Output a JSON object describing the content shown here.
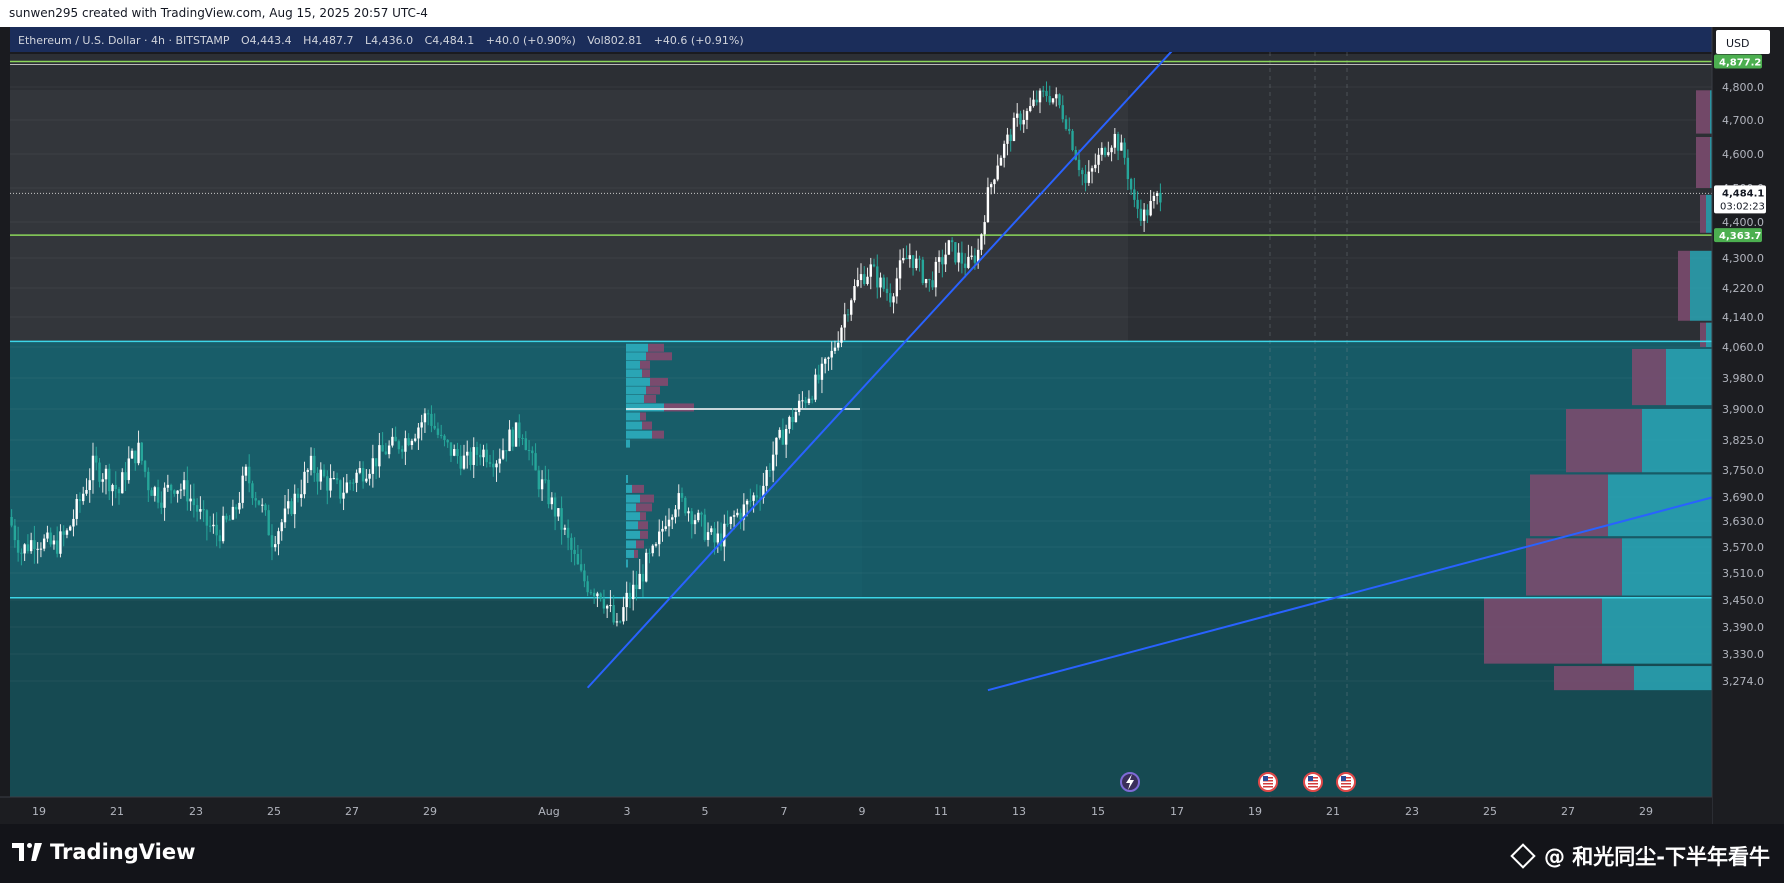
{
  "header": {
    "attribution": "sunwen295 created with TradingView.com, Aug 15, 2025 20:57 UTC-4"
  },
  "legend": {
    "symbol": "Ethereum / U.S. Dollar · 4h · BITSTAMP",
    "open_label": "O",
    "open": "4,443.4",
    "high_label": "H",
    "high": "4,487.7",
    "low_label": "L",
    "low": "4,436.0",
    "close_label": "C",
    "close": "4,484.1",
    "change": "+40.0 (+0.90%)",
    "vol_label": "Vol",
    "vol": "802.81",
    "vol_change": "+40.6 (+0.91%)"
  },
  "currency_button": "USD",
  "price_tags": {
    "upper_level": "4,877.2",
    "last_price": "4,484.1",
    "countdown": "03:02:23",
    "support_level": "4,363.7"
  },
  "event_icons": [
    "lightning-icon",
    "us-flag-icon",
    "us-flag-icon",
    "us-flag-icon"
  ],
  "footer": {
    "brand": "TradingView",
    "watermark": "@ 和光同尘-下半年看牛"
  },
  "colors": {
    "up": "#26a69a",
    "down": "#26a69a",
    "bull_body": "#ffffff",
    "trendline": "#2962ff",
    "zone": "#175a66",
    "cyan_line": "#3cd6e8",
    "green_line": "#8bd65a",
    "header_bg": "#1b2d5a",
    "profile_up": "#2aa5b5",
    "profile_down": "#7a4b6e"
  },
  "chart_data": {
    "type": "candlestick",
    "symbol": "ETHUSD",
    "interval": "4h",
    "y_axis": {
      "ticks": [
        4800,
        4700,
        4600,
        4500,
        4400,
        4300,
        4220,
        4140,
        4060,
        3980,
        3900,
        3825,
        3750,
        3690,
        3630,
        3570,
        3510,
        3450,
        3390,
        3330,
        3274
      ],
      "tick_labels": [
        "4,800.0",
        "4,700.0",
        "4,600.0",
        "4,500.0",
        "4,400.0",
        "4,300.0",
        "4,220.0",
        "4,140.0",
        "4,060.0",
        "3,980.0",
        "3,900.0",
        "3,825.0",
        "3,750.0",
        "3,690.0",
        "3,630.0",
        "3,570.0",
        "3,510.0",
        "3,450.0",
        "3,390.0",
        "3,330.0",
        "3,274.0"
      ],
      "ylim": [
        3250,
        5000
      ]
    },
    "x_axis": {
      "tick_labels": [
        "19",
        "21",
        "23",
        "25",
        "27",
        "29",
        "Aug",
        "3",
        "5",
        "7",
        "9",
        "11",
        "13",
        "15",
        "17",
        "19",
        "21",
        "23",
        "25",
        "27",
        "29"
      ],
      "xlim_bars": [
        0,
        523
      ]
    },
    "horizontal_levels": [
      {
        "price": 4877.2,
        "style": "green"
      },
      {
        "price": 4363.7,
        "style": "green"
      },
      {
        "price": 4075,
        "style": "cyan"
      },
      {
        "price": 3455,
        "style": "cyan"
      },
      {
        "price": 3900,
        "style": "white-poc"
      }
    ],
    "trendlines": [
      {
        "from": [
          177,
          3260
        ],
        "to": [
          365,
          5000
        ]
      },
      {
        "from": [
          300,
          3255
        ],
        "to": [
          523,
          3690
        ]
      }
    ],
    "volume_profile": {
      "right": [
        {
          "lo": 4660,
          "hi": 4790,
          "up": 2,
          "down": 14
        },
        {
          "lo": 4500,
          "hi": 4650,
          "up": 2,
          "down": 14
        },
        {
          "lo": 4370,
          "hi": 4480,
          "up": 6,
          "down": 6
        },
        {
          "lo": 4130,
          "hi": 4320,
          "up": 22,
          "down": 12
        },
        {
          "lo": 4060,
          "hi": 4125,
          "up": 6,
          "down": 6
        },
        {
          "lo": 3910,
          "hi": 4055,
          "up": 46,
          "down": 34
        },
        {
          "lo": 3745,
          "hi": 3900,
          "up": 70,
          "down": 76
        },
        {
          "lo": 3595,
          "hi": 3740,
          "up": 104,
          "down": 78
        },
        {
          "lo": 3460,
          "hi": 3590,
          "up": 90,
          "down": 96
        },
        {
          "lo": 3310,
          "hi": 3455,
          "up": 110,
          "down": 118
        },
        {
          "lo": 3255,
          "hi": 3305,
          "up": 78,
          "down": 80
        }
      ],
      "left": [
        {
          "price": 4058,
          "up": 22,
          "down": 16
        },
        {
          "price": 4036,
          "up": 20,
          "down": 26
        },
        {
          "price": 4014,
          "up": 14,
          "down": 10
        },
        {
          "price": 3992,
          "up": 16,
          "down": 8
        },
        {
          "price": 3970,
          "up": 24,
          "down": 18
        },
        {
          "price": 3948,
          "up": 20,
          "down": 14
        },
        {
          "price": 3926,
          "up": 18,
          "down": 12
        },
        {
          "price": 3904,
          "up": 38,
          "down": 30
        },
        {
          "price": 3882,
          "up": 14,
          "down": 6
        },
        {
          "price": 3860,
          "up": 16,
          "down": 10
        },
        {
          "price": 3838,
          "up": 26,
          "down": 12
        },
        {
          "price": 3816,
          "up": 4,
          "down": 0
        },
        {
          "price": 3730,
          "up": 2,
          "down": 0
        },
        {
          "price": 3708,
          "up": 6,
          "down": 12
        },
        {
          "price": 3686,
          "up": 14,
          "down": 14
        },
        {
          "price": 3664,
          "up": 10,
          "down": 16
        },
        {
          "price": 3642,
          "up": 14,
          "down": 6
        },
        {
          "price": 3620,
          "up": 12,
          "down": 10
        },
        {
          "price": 3598,
          "up": 14,
          "down": 8
        },
        {
          "price": 3576,
          "up": 10,
          "down": 8
        },
        {
          "price": 3554,
          "up": 8,
          "down": 4
        },
        {
          "price": 3532,
          "up": 2,
          "down": 0
        }
      ]
    },
    "waypoints": [
      [
        0,
        3640
      ],
      [
        4,
        3560
      ],
      [
        8,
        3590
      ],
      [
        14,
        3570
      ],
      [
        18,
        3600
      ],
      [
        22,
        3680
      ],
      [
        26,
        3760
      ],
      [
        30,
        3740
      ],
      [
        34,
        3700
      ],
      [
        37,
        3770
      ],
      [
        40,
        3800
      ],
      [
        43,
        3720
      ],
      [
        47,
        3690
      ],
      [
        51,
        3720
      ],
      [
        55,
        3700
      ],
      [
        60,
        3630
      ],
      [
        64,
        3600
      ],
      [
        69,
        3640
      ],
      [
        73,
        3740
      ],
      [
        77,
        3680
      ],
      [
        81,
        3590
      ],
      [
        85,
        3640
      ],
      [
        89,
        3700
      ],
      [
        93,
        3760
      ],
      [
        97,
        3730
      ],
      [
        102,
        3700
      ],
      [
        107,
        3740
      ],
      [
        112,
        3770
      ],
      [
        116,
        3800
      ],
      [
        121,
        3820
      ],
      [
        125,
        3850
      ],
      [
        129,
        3890
      ],
      [
        133,
        3820
      ],
      [
        137,
        3790
      ],
      [
        141,
        3770
      ],
      [
        145,
        3800
      ],
      [
        150,
        3780
      ],
      [
        154,
        3830
      ],
      [
        158,
        3850
      ],
      [
        162,
        3740
      ],
      [
        166,
        3690
      ],
      [
        170,
        3620
      ],
      [
        173,
        3560
      ],
      [
        176,
        3500
      ],
      [
        179,
        3480
      ],
      [
        182,
        3470
      ],
      [
        185,
        3420
      ],
      [
        187,
        3380
      ],
      [
        190,
        3450
      ],
      [
        193,
        3480
      ],
      [
        196,
        3530
      ],
      [
        199,
        3560
      ],
      [
        202,
        3640
      ],
      [
        205,
        3680
      ],
      [
        208,
        3670
      ],
      [
        211,
        3640
      ],
      [
        214,
        3610
      ],
      [
        217,
        3580
      ],
      [
        220,
        3600
      ],
      [
        223,
        3640
      ],
      [
        226,
        3660
      ],
      [
        229,
        3690
      ],
      [
        232,
        3720
      ],
      [
        235,
        3790
      ],
      [
        238,
        3840
      ],
      [
        241,
        3880
      ],
      [
        244,
        3920
      ],
      [
        247,
        3950
      ],
      [
        250,
        3990
      ],
      [
        253,
        4040
      ],
      [
        256,
        4120
      ],
      [
        259,
        4200
      ],
      [
        262,
        4250
      ],
      [
        265,
        4270
      ],
      [
        268,
        4230
      ],
      [
        271,
        4200
      ],
      [
        274,
        4270
      ],
      [
        277,
        4310
      ],
      [
        280,
        4270
      ],
      [
        283,
        4230
      ],
      [
        286,
        4280
      ],
      [
        289,
        4330
      ],
      [
        292,
        4300
      ],
      [
        295,
        4280
      ],
      [
        298,
        4320
      ],
      [
        301,
        4480
      ],
      [
        304,
        4580
      ],
      [
        307,
        4640
      ],
      [
        310,
        4700
      ],
      [
        313,
        4720
      ],
      [
        316,
        4760
      ],
      [
        319,
        4780
      ],
      [
        322,
        4760
      ],
      [
        325,
        4700
      ],
      [
        328,
        4600
      ],
      [
        331,
        4510
      ],
      [
        334,
        4570
      ],
      [
        337,
        4620
      ],
      [
        340,
        4650
      ],
      [
        343,
        4590
      ],
      [
        346,
        4450
      ],
      [
        349,
        4420
      ],
      [
        352,
        4460
      ],
      [
        354,
        4484
      ]
    ]
  }
}
